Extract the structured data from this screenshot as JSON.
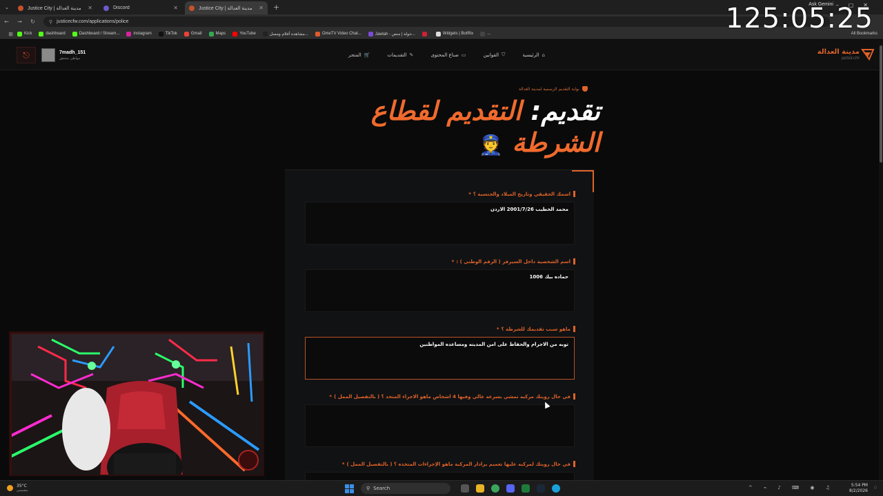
{
  "browser": {
    "tabs": [
      {
        "title": "Justice City | مدينة العدالة",
        "active": false,
        "fav": "jc"
      },
      {
        "title": "Discord",
        "active": false,
        "fav": "discord"
      },
      {
        "title": "Justice City | مدينة العدالة",
        "active": true,
        "fav": "jc"
      }
    ],
    "url": "justicecfw.com/applications/police",
    "gemini": "Ask Gemini",
    "bookmarks": [
      {
        "label": "Kick",
        "color": "#53fc18"
      },
      {
        "label": "dashboard",
        "color": "#53fc18"
      },
      {
        "label": "Dashboard / Stream...",
        "color": "#53fc18"
      },
      {
        "label": "instagram",
        "color": "#d6249f"
      },
      {
        "label": "TikTok",
        "color": "#111111"
      },
      {
        "label": "Gmail",
        "color": "#ea4335"
      },
      {
        "label": "Maps",
        "color": "#34a853"
      },
      {
        "label": "YouTube",
        "color": "#ff0000"
      },
      {
        "label": "مشاهدة أفلام ومسل...",
        "color": "#222222"
      },
      {
        "label": "OmeTV Video Chat...",
        "color": "#e05a2b"
      },
      {
        "label": "Jawlah - جولة | منص...",
        "color": "#7b4bd6"
      },
      {
        "label": "",
        "color": "#cc2233"
      },
      {
        "label": "Widgets | BotRix",
        "color": "#dddddd"
      },
      {
        "label": "...",
        "color": "#444444"
      }
    ],
    "all_bookmarks": "All Bookmarks"
  },
  "overlay": {
    "timer": "125:05:25"
  },
  "header": {
    "user_name": "7madh_151",
    "user_role": "مواطن متحقق",
    "nav": [
      {
        "label": "الرئيسية",
        "icon": "home-icon",
        "glyph": "⌂"
      },
      {
        "label": "القوانين",
        "icon": "shield-icon",
        "glyph": "⛉"
      },
      {
        "label": "صناع المحتوى",
        "icon": "video-icon",
        "glyph": "▭"
      },
      {
        "label": "التقديمات",
        "icon": "edit-icon",
        "glyph": "✎"
      },
      {
        "label": "المتجر",
        "icon": "cart-icon",
        "glyph": "🛒"
      }
    ],
    "brand_name": "مدينة العدالة",
    "brand_sub": "JUSTICE CITY"
  },
  "hero": {
    "portal": "بوابة التقديم الرسمية لمدينة العدالة",
    "title_white": "تقديم:",
    "title_orange": "التقديم لقطاع الشرطة",
    "emoji": "👮"
  },
  "form": {
    "questions": [
      {
        "label": "اسمك الحقيقي وتاريخ الميلاد والجنسية ؟",
        "value": "محمد الخطيب 2001/7/26 الاردن"
      },
      {
        "label": "اسم الشخصية داخل السيرفر ( الرقم الوطني ) :",
        "value": "حماده بيك 1006"
      },
      {
        "label": "ماهو سبب تقديمك للشرطة ؟",
        "value": "توبه من الاجرام والحفاظ على امن المدينه ومساعده المواطنين"
      },
      {
        "label": "في حال رويتك مركبه تمشي بسرعه عالي وفيها 4 اشخاص ماهو الاجراء المتخذ ؟ ( بالتفصيل الممل )",
        "value": ""
      },
      {
        "label": "في حال رويتك لمركبه عليها تعميم برادار المركبة ماهو الإجراءات المتخذه ؟ ( بالتفصيل الممل )",
        "value": ""
      }
    ],
    "required_mark": "*"
  },
  "taskbar": {
    "temp": "35°C",
    "weather": "مشمس",
    "search": "Search",
    "time": "5:54 PM",
    "date": "8/2/2026"
  }
}
